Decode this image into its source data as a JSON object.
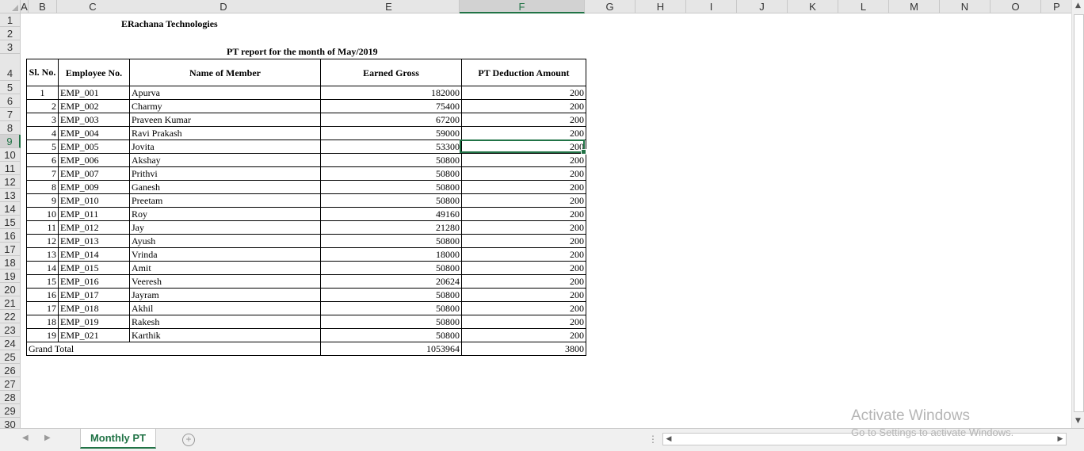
{
  "columns": [
    "A",
    "B",
    "C",
    "D",
    "E",
    "F",
    "G",
    "H",
    "I",
    "J",
    "K",
    "L",
    "M",
    "N",
    "O",
    "P"
  ],
  "rows": [
    "1",
    "2",
    "3",
    "4",
    "5",
    "6",
    "7",
    "8",
    "9",
    "10",
    "11",
    "12",
    "13",
    "14",
    "15",
    "16",
    "17",
    "18",
    "19",
    "20",
    "21",
    "22",
    "23",
    "24",
    "25",
    "26",
    "27",
    "28",
    "29",
    "30"
  ],
  "company": "ERachana Technologies",
  "report_title": "PT report for the month of May/2019",
  "headers": {
    "sl": "Sl. No.",
    "emp": "Employee No.",
    "name": "Name of Member",
    "gross": "Earned Gross",
    "pt": "PT Deduction Amount"
  },
  "records": [
    {
      "sl": "1",
      "emp": "EMP_001",
      "name": "Apurva",
      "gross": "182000",
      "pt": "200"
    },
    {
      "sl": "2",
      "emp": "EMP_002",
      "name": "Charmy",
      "gross": "75400",
      "pt": "200"
    },
    {
      "sl": "3",
      "emp": "EMP_003",
      "name": "Praveen Kumar",
      "gross": "67200",
      "pt": "200"
    },
    {
      "sl": "4",
      "emp": "EMP_004",
      "name": "Ravi Prakash",
      "gross": "59000",
      "pt": "200"
    },
    {
      "sl": "5",
      "emp": "EMP_005",
      "name": "Jovita",
      "gross": "53300",
      "pt": "200"
    },
    {
      "sl": "6",
      "emp": "EMP_006",
      "name": "Akshay",
      "gross": "50800",
      "pt": "200"
    },
    {
      "sl": "7",
      "emp": "EMP_007",
      "name": "Prithvi",
      "gross": "50800",
      "pt": "200"
    },
    {
      "sl": "8",
      "emp": "EMP_009",
      "name": "Ganesh",
      "gross": "50800",
      "pt": "200"
    },
    {
      "sl": "9",
      "emp": "EMP_010",
      "name": "Preetam",
      "gross": "50800",
      "pt": "200"
    },
    {
      "sl": "10",
      "emp": "EMP_011",
      "name": "Roy",
      "gross": "49160",
      "pt": "200"
    },
    {
      "sl": "11",
      "emp": "EMP_012",
      "name": "Jay",
      "gross": "21280",
      "pt": "200"
    },
    {
      "sl": "12",
      "emp": "EMP_013",
      "name": "Ayush",
      "gross": "50800",
      "pt": "200"
    },
    {
      "sl": "13",
      "emp": "EMP_014",
      "name": "Vrinda",
      "gross": "18000",
      "pt": "200"
    },
    {
      "sl": "14",
      "emp": "EMP_015",
      "name": "Amit",
      "gross": "50800",
      "pt": "200"
    },
    {
      "sl": "15",
      "emp": "EMP_016",
      "name": "Veeresh",
      "gross": "20624",
      "pt": "200"
    },
    {
      "sl": "16",
      "emp": "EMP_017",
      "name": "Jayram",
      "gross": "50800",
      "pt": "200"
    },
    {
      "sl": "17",
      "emp": "EMP_018",
      "name": "Akhil",
      "gross": "50800",
      "pt": "200"
    },
    {
      "sl": "18",
      "emp": "EMP_019",
      "name": "Rakesh",
      "gross": "50800",
      "pt": "200"
    },
    {
      "sl": "19",
      "emp": "EMP_021",
      "name": "Karthik",
      "gross": "50800",
      "pt": "200"
    }
  ],
  "grand_total": {
    "label": "Grand Total",
    "gross": "1053964",
    "pt": "3800"
  },
  "selected": {
    "column": "F",
    "row": "9"
  },
  "sheet_tab": "Monthly PT",
  "watermark": {
    "line1": "Activate Windows",
    "line2": "Go to Settings to activate Windows."
  },
  "colors": {
    "accent": "#217346",
    "header_bg": "#e6e6e6"
  }
}
